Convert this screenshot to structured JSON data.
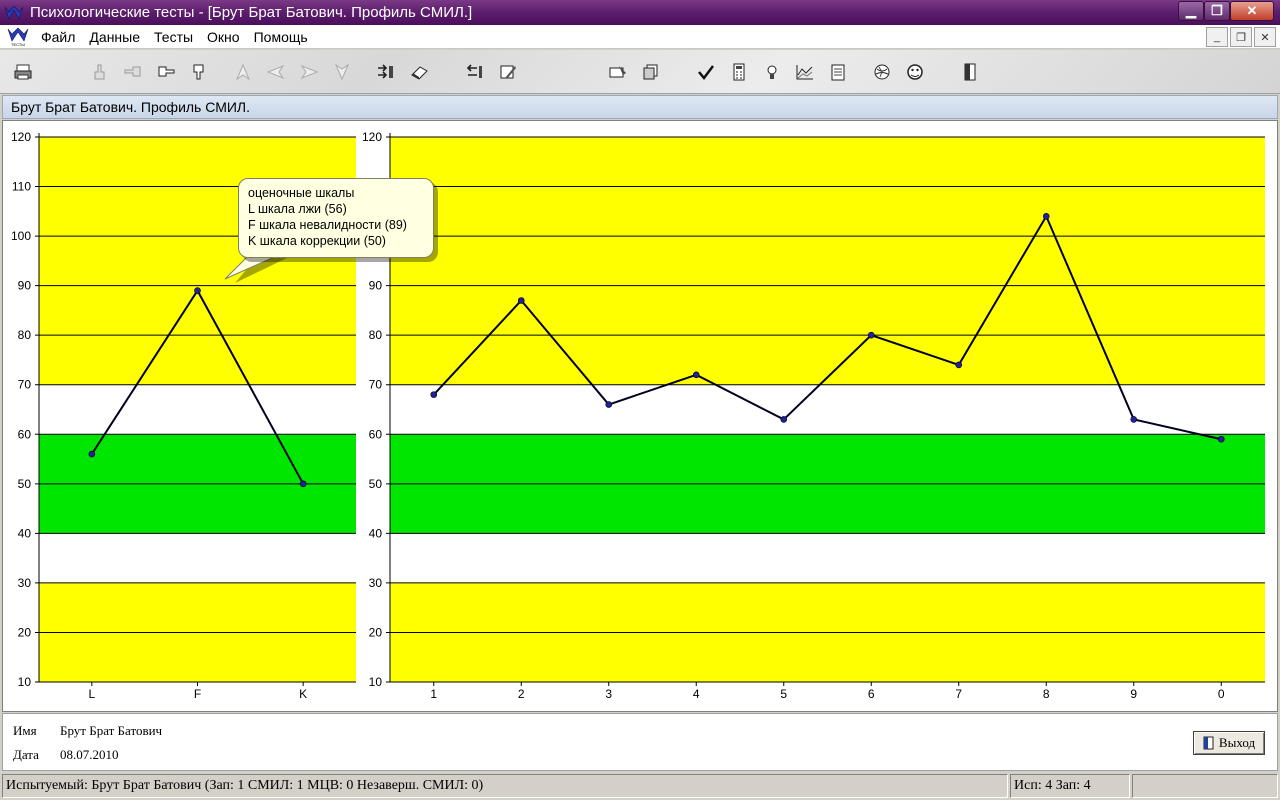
{
  "window": {
    "title": "Психологические тесты - [Брут Брат Батович. Профиль СМИЛ.]",
    "min_label": "▁",
    "max_label": "❐",
    "close_label": "✕"
  },
  "menu": {
    "items": [
      "Файл",
      "Данные",
      "Тесты",
      "Окно",
      "Помощь"
    ],
    "mdi_min": "_",
    "mdi_restore": "❐",
    "mdi_close": "✕"
  },
  "toolbar": {
    "icons": [
      "printer-icon",
      "hand-up-icon",
      "hand-left-icon",
      "hand-right-icon",
      "hand-down-icon",
      "arrow-up-icon",
      "arrow-left-icon",
      "arrow-right-icon",
      "arrow-down-icon",
      "sort-icon",
      "eraser-icon",
      "list-icon",
      "edit-icon",
      "card-icon",
      "copy-icon",
      "check-icon",
      "calculator-icon",
      "bulb-icon",
      "chart-icon",
      "notes-icon",
      "globe-icon",
      "face-icon",
      "door-icon"
    ]
  },
  "document": {
    "caption": "Брут Брат Батович. Профиль СМИЛ."
  },
  "colors": {
    "yellow": "#ffff00",
    "green": "#00e600",
    "white": "#ffffff",
    "line": "#000020",
    "marker": "#2020a0"
  },
  "chart_data": [
    {
      "type": "line",
      "categories": [
        "L",
        "F",
        "K"
      ],
      "values": [
        56,
        89,
        50
      ],
      "ylim": [
        10,
        120
      ],
      "yticks": [
        10,
        20,
        30,
        40,
        50,
        60,
        70,
        80,
        90,
        100,
        110,
        120
      ],
      "bands": [
        {
          "from": 10,
          "to": 30,
          "color": "#ffff00"
        },
        {
          "from": 30,
          "to": 40,
          "color": "#ffffff"
        },
        {
          "from": 40,
          "to": 60,
          "color": "#00e600"
        },
        {
          "from": 60,
          "to": 70,
          "color": "#ffffff"
        },
        {
          "from": 70,
          "to": 120,
          "color": "#ffff00"
        }
      ],
      "grid": true
    },
    {
      "type": "line",
      "categories": [
        "1",
        "2",
        "3",
        "4",
        "5",
        "6",
        "7",
        "8",
        "9",
        "0"
      ],
      "values": [
        68,
        87,
        66,
        72,
        63,
        80,
        74,
        104,
        63,
        59
      ],
      "ylim": [
        10,
        120
      ],
      "yticks": [
        10,
        20,
        30,
        40,
        50,
        60,
        70,
        80,
        90,
        100,
        110,
        120
      ],
      "bands": [
        {
          "from": 10,
          "to": 30,
          "color": "#ffff00"
        },
        {
          "from": 30,
          "to": 40,
          "color": "#ffffff"
        },
        {
          "from": 40,
          "to": 60,
          "color": "#00e600"
        },
        {
          "from": 60,
          "to": 70,
          "color": "#ffffff"
        },
        {
          "from": 70,
          "to": 120,
          "color": "#ffff00"
        }
      ],
      "grid": true
    }
  ],
  "tooltip": {
    "lines": [
      "оценочные шкалы",
      "L шкала лжи (56)",
      "F шкала невалидности (89)",
      "K шкала коррекции (50)"
    ]
  },
  "info": {
    "name_label": "Имя",
    "name_value": "Брут Брат Батович",
    "date_label": "Дата",
    "date_value": "08.07.2010",
    "exit_label": "Выход"
  },
  "status": {
    "main": "Испытуемый: Брут Брат Батович (Зап: 1 СМИЛ: 1 МЦВ: 0 Незаверш. СМИЛ: 0)",
    "counts": "Исп: 4 Зап: 4",
    "extra": ""
  }
}
